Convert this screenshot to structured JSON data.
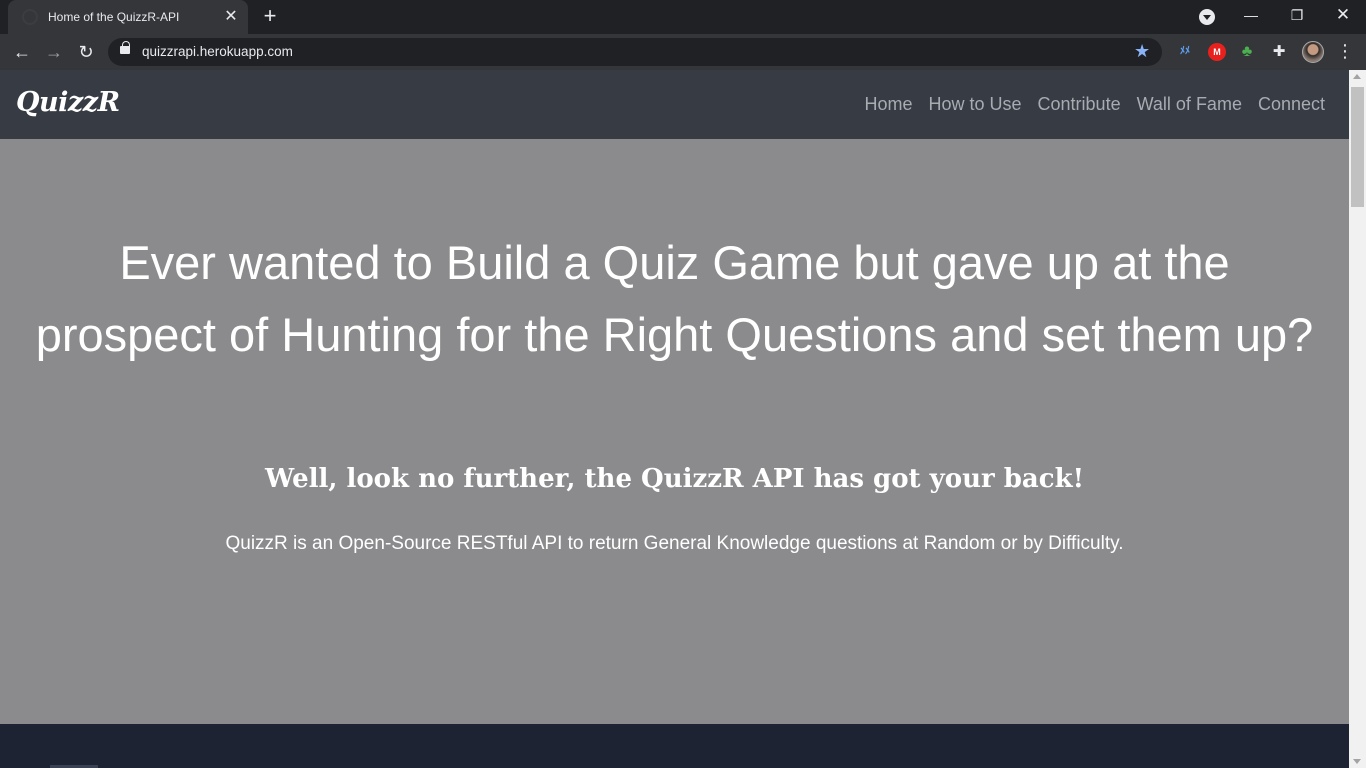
{
  "browser": {
    "tab_title": "Home of the QuizzR-API",
    "url": "quizzrapi.herokuapp.com",
    "icons": {
      "back": "arrow-left-icon",
      "forward": "arrow-right-icon",
      "reload": "reload-icon",
      "lock": "lock-icon",
      "bookmark": "star-icon",
      "extensions": [
        "extension-blue-icon",
        "mega-icon",
        "tree-icon",
        "puzzle-icon"
      ],
      "menu": "kebab-menu-icon"
    },
    "colors": {
      "frame": "#202124",
      "toolbar": "#35363a",
      "star": "#8ab4f8"
    }
  },
  "site": {
    "brand": "QuizzR",
    "nav": [
      "Home",
      "How to Use",
      "Contribute",
      "Wall of Fame",
      "Connect"
    ],
    "hero": {
      "title": "Ever wanted to Build a Quiz Game but gave up at the prospect of Hunting for the Right Questions and set them up?",
      "subtitle": "Well, look no further, the QuizzR API has got your back!",
      "description": "QuizzR is an Open-Source RESTful API to return General Knowledge questions at Random or by Difficulty."
    },
    "colors": {
      "navbar": "#363b44",
      "hero": "#8b8b8d",
      "footer": "#1d2333"
    }
  }
}
